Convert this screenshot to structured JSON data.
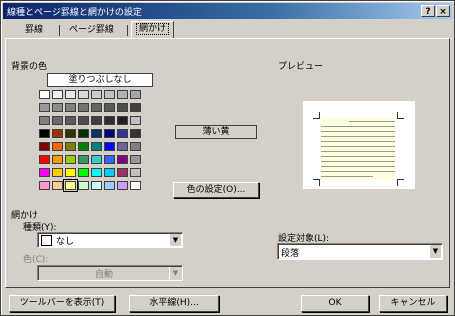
{
  "window": {
    "title": "線種とページ罫線と網かけの設定",
    "help_label": "?",
    "close_label": "×"
  },
  "tabs": [
    {
      "label": "罫線"
    },
    {
      "label": "ページ罫線"
    },
    {
      "label": "網かけ"
    }
  ],
  "background": {
    "section_label": "背景の色",
    "no_fill_label": "塗りつぶしなし",
    "selected_color_name": "薄い黄",
    "more_colors_button": "色の設定(O)...",
    "palette_rows": [
      [
        "#ffffff",
        "#f2f2f2",
        "#e6e6e6",
        "#d9d9d9",
        "#cccccc",
        "#c0c0c0",
        "#b3b3b3",
        "#a6a6a6"
      ],
      [
        "#999999",
        "#8c8c8c",
        "#808080",
        "#737373",
        "#666666",
        "#595959",
        "#4d4d4d",
        "#404040"
      ],
      [
        "#7f7f7f",
        "#6b6b6b",
        "#5c5c5c",
        "#4d4d4d",
        "#3d3d3d",
        "#2e2e2e",
        "#1f1f1f",
        "#bfbfbf"
      ],
      [
        "#000000",
        "#993300",
        "#333300",
        "#003300",
        "#003366",
        "#000080",
        "#333399",
        "#333333"
      ],
      [
        "#800000",
        "#ff6600",
        "#808000",
        "#008000",
        "#008080",
        "#0000ff",
        "#666699",
        "#808080"
      ],
      [
        "#ff0000",
        "#ff9900",
        "#99cc00",
        "#339966",
        "#33cccc",
        "#3366ff",
        "#800080",
        "#969696"
      ],
      [
        "#ff00ff",
        "#ffcc00",
        "#ffff00",
        "#00ff00",
        "#00ffff",
        "#00ccff",
        "#993366",
        "#c0c0c0"
      ],
      [
        "#ff99cc",
        "#ffcc99",
        "#ffff99",
        "#ccffcc",
        "#ccffff",
        "#99ccff",
        "#cc99ff",
        "#ffffff"
      ]
    ],
    "selected_swatch": "#ffff99"
  },
  "shading": {
    "section_label": "網かけ",
    "style_label": "種類(Y):",
    "style_value": "なし",
    "color_label": "色(C):",
    "color_value": "自動"
  },
  "preview": {
    "section_label": "プレビュー"
  },
  "apply_to": {
    "label": "設定対象(L):",
    "value": "段落"
  },
  "footer": {
    "toolbar_button": "ツールバーを表示(T)",
    "horizontal_line_button": "水平線(H)...",
    "ok_button": "OK",
    "cancel_button": "キャンセル"
  }
}
